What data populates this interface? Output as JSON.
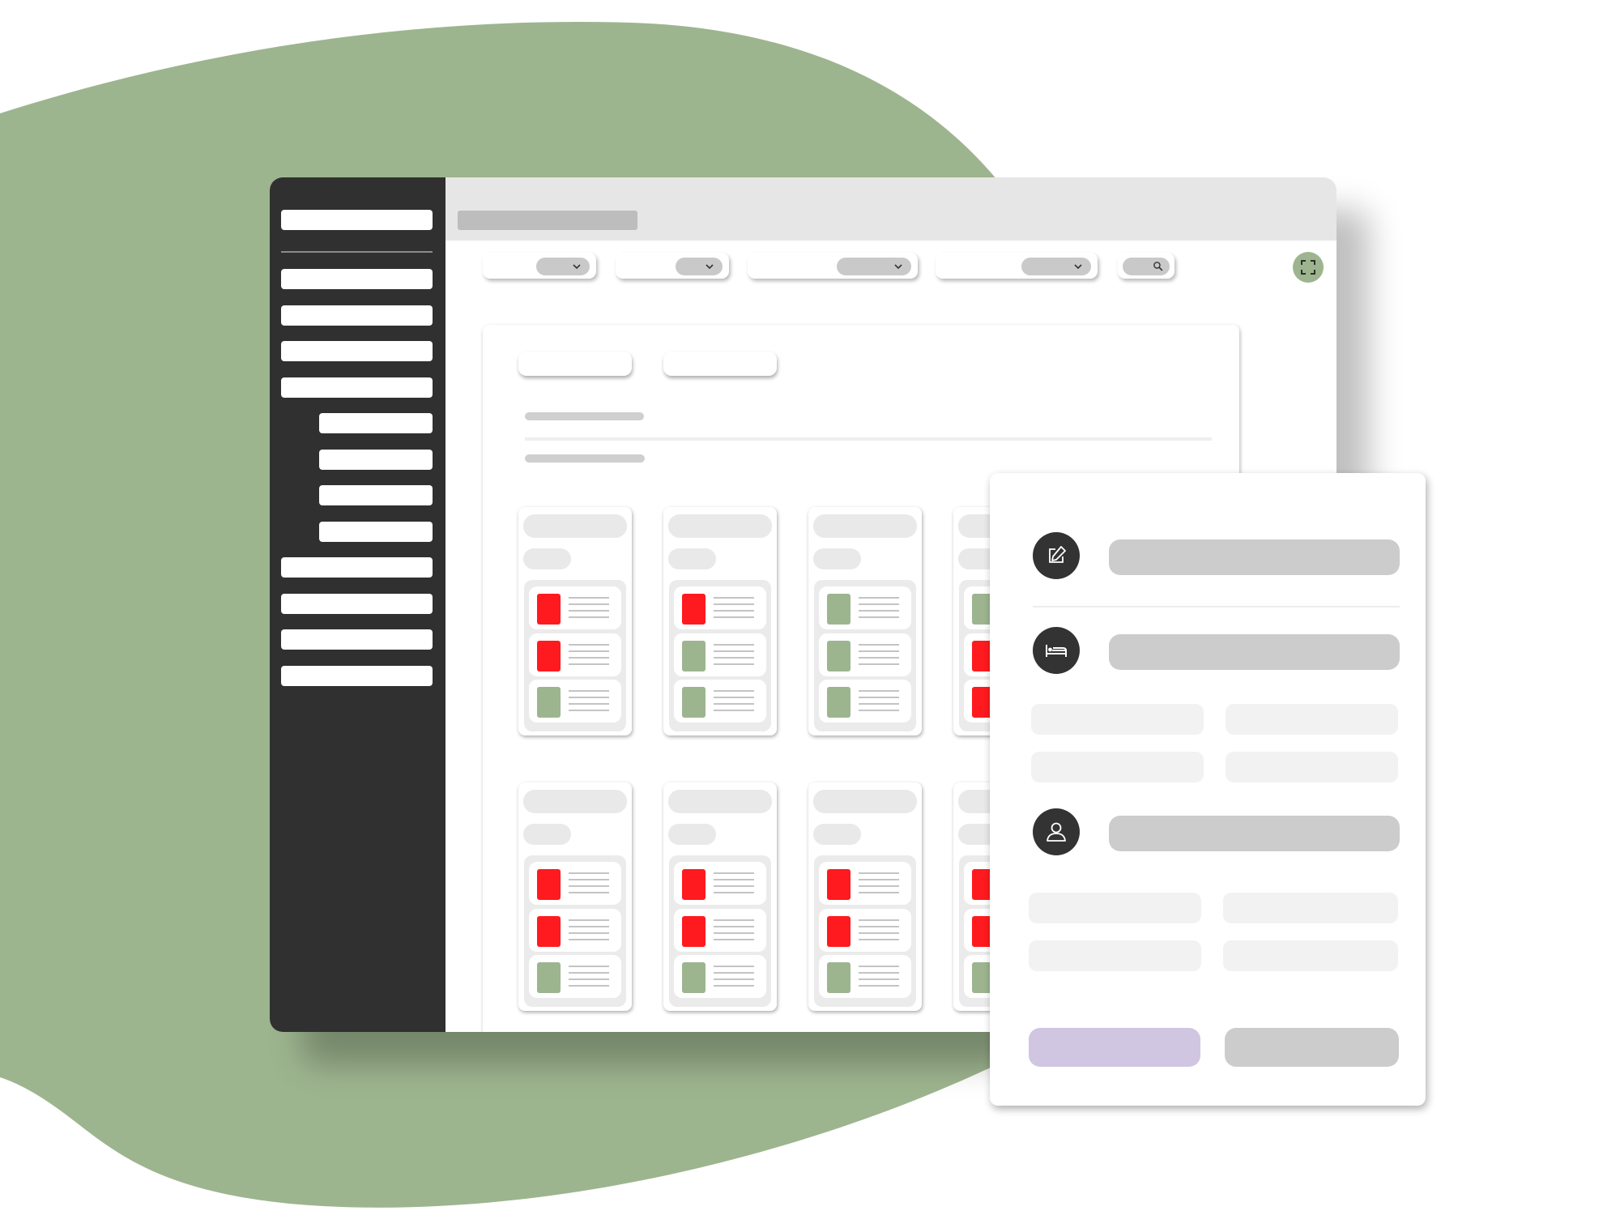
{
  "theme": {
    "background_blob": "#9db58f",
    "sidebar": "#303030",
    "header": "#e6e6e6",
    "occupied": "#ff1a1f",
    "available": "#9db58f",
    "primary_action": "#d0c6e1",
    "secondary_action": "#cccccc",
    "icon_circle": "#333333"
  },
  "sidebar": {
    "items": [
      {
        "level": 0
      },
      {
        "level": 0
      },
      {
        "level": 0
      },
      {
        "level": 0
      },
      {
        "level": 1
      },
      {
        "level": 1
      },
      {
        "level": 1
      },
      {
        "level": 1
      },
      {
        "level": 0
      },
      {
        "level": 0
      },
      {
        "level": 0
      },
      {
        "level": 0
      }
    ]
  },
  "toolbar": {
    "filters": [
      {
        "icon": "chevron-down-icon"
      },
      {
        "icon": "chevron-down-icon"
      },
      {
        "icon": "chevron-down-icon"
      },
      {
        "icon": "chevron-down-icon"
      }
    ],
    "search": {
      "icon": "search-icon"
    },
    "fullscreen": {
      "icon": "fullscreen-icon"
    }
  },
  "rooms": {
    "cards": [
      {
        "statuses": [
          "occupied",
          "occupied",
          "available"
        ]
      },
      {
        "statuses": [
          "occupied",
          "available",
          "available"
        ]
      },
      {
        "statuses": [
          "available",
          "available",
          "available"
        ]
      },
      {
        "statuses": [
          "available",
          "occupied",
          "occupied"
        ]
      },
      {
        "statuses": [
          "occupied",
          "occupied",
          "available"
        ]
      },
      {
        "statuses": [
          "occupied",
          "occupied",
          "available"
        ]
      },
      {
        "statuses": [
          "occupied",
          "occupied",
          "available"
        ]
      },
      {
        "statuses": [
          "occupied",
          "occupied",
          "available"
        ]
      }
    ]
  },
  "detail": {
    "sections": [
      {
        "icon": "edit-icon"
      },
      {
        "icon": "bed-icon"
      },
      {
        "icon": "user-icon"
      }
    ]
  }
}
